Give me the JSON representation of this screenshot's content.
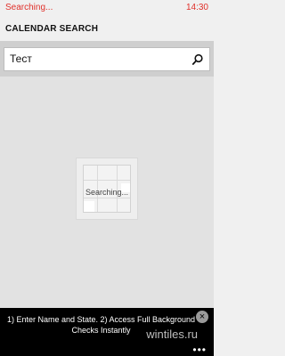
{
  "status": {
    "left_text": "Searching...",
    "time": "14:30"
  },
  "header": {
    "title": "CALENDAR SEARCH"
  },
  "search": {
    "value": "Тест",
    "icon": "search-icon"
  },
  "main": {
    "loading_text": "Searching..."
  },
  "ad": {
    "text": "1) Enter Name and State. 2) Access Full Background Checks Instantly",
    "close_label": "×",
    "watermark": "wintiles.ru"
  },
  "appbar": {
    "more_label": "•••"
  },
  "colors": {
    "status": "#e0302a",
    "banner": "#000000"
  }
}
